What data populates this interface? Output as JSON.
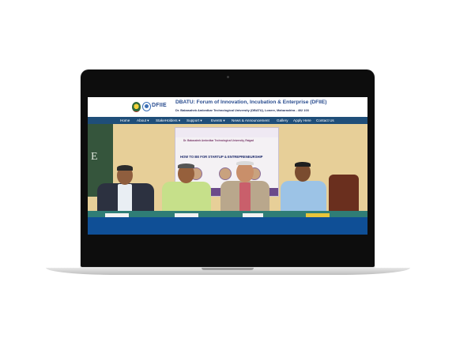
{
  "site": {
    "logo_text": "DFIIE",
    "title": "DBATU: Forum of Innovation, Incubation & Enterprise (DFIIE)",
    "subtitle": "Dr. Babasaheb Ambedkar Technological University (DBATU), Lonere, Maharashtra - 402 103"
  },
  "nav": {
    "items": [
      {
        "label": "Home"
      },
      {
        "label": "About ▾"
      },
      {
        "label": "StakeHolders ▾"
      },
      {
        "label": "Support ▾"
      },
      {
        "label": "Events ▾"
      },
      {
        "label": "News & Announcement"
      },
      {
        "label": "Gallery"
      },
      {
        "label": "Apply Here"
      },
      {
        "label": "Contact Us"
      }
    ]
  },
  "hero": {
    "banner_line1": "Dr. Babasaheb Ambedkar Technological University, Raigad",
    "banner_line2": "HOW TO BE FOR STARTUP & ENTREPRENEURSHIP"
  },
  "colors": {
    "navbar": "#1f4e79",
    "title": "#2a4d8f",
    "table_front": "#0f4f96"
  }
}
